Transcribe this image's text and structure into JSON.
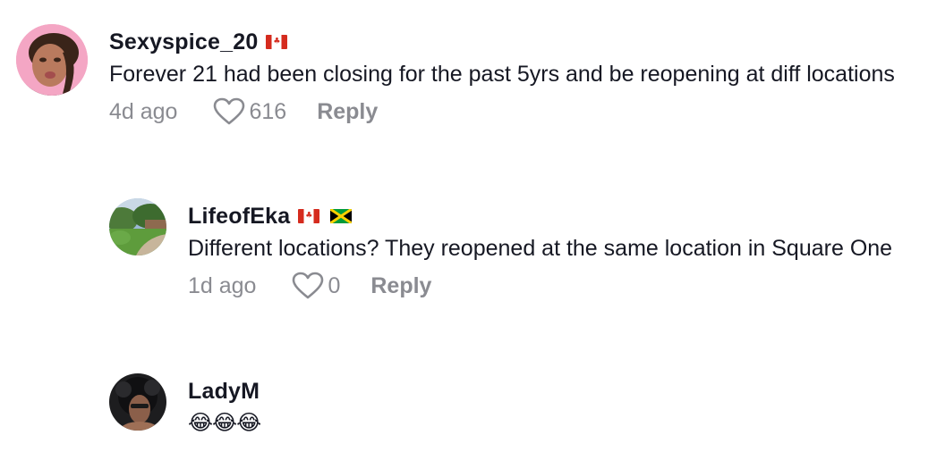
{
  "comments": [
    {
      "username": "Sexyspice_20",
      "flags": [
        "canada"
      ],
      "text": "Forever 21 had been closing for the past 5yrs and be reopening at diff locations",
      "time": "4d ago",
      "likes": "616",
      "reply_label": "Reply"
    },
    {
      "username": "LifeofEka",
      "flags": [
        "canada",
        "jamaica"
      ],
      "text": "Different locations? They reopened at the same location in Square One",
      "time": "1d ago",
      "likes": "0",
      "reply_label": "Reply"
    },
    {
      "username": "LadyM",
      "flags": [],
      "text": "😂😂😂",
      "time": "",
      "likes": "",
      "reply_label": ""
    }
  ],
  "icons": {
    "like": "heart-outline-icon",
    "flag_canada": "canada-flag-icon",
    "flag_jamaica": "jamaica-flag-icon"
  },
  "colors": {
    "text_primary": "#161823",
    "text_secondary": "#8a8b91",
    "background": "#ffffff"
  }
}
